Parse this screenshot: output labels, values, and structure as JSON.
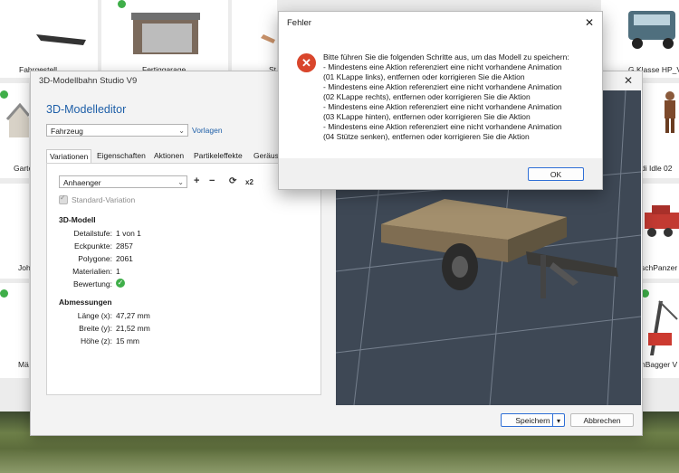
{
  "catalog": {
    "labels": [
      "Fahrgestell",
      "Fertiggarage",
      "St",
      "G Klasse HP_V",
      "Garte",
      "di Idle 02",
      "Joh",
      "schPanzer",
      "Mä",
      "nBagger V"
    ]
  },
  "editor": {
    "title": "3D-Modellbahn Studio V9",
    "close_glyph": "✕",
    "heading": "3D-Modelleditor",
    "category_select": "Fahrzeug",
    "vorlagen_link": "Vorlagen",
    "tabs": [
      "Variationen",
      "Eigenschaften",
      "Aktionen",
      "Partikeleffekte",
      "Geräus"
    ],
    "variation_select": "Anhaenger",
    "toolbar": {
      "add": "+",
      "remove": "−",
      "refresh": "⟳",
      "x2": "x2"
    },
    "standard_variation": "Standard-Variation",
    "model_section": "3D-Modell",
    "model_fields": [
      {
        "label": "Detailstufe:",
        "value": "1 von 1"
      },
      {
        "label": "Eckpunkte:",
        "value": "2857"
      },
      {
        "label": "Polygone:",
        "value": "2061"
      },
      {
        "label": "Materialien:",
        "value": "1"
      },
      {
        "label": "Bewertung:",
        "value": ""
      }
    ],
    "dimensions_section": "Abmessungen",
    "dimension_fields": [
      {
        "label": "Länge (x):",
        "value": "47,27 mm"
      },
      {
        "label": "Breite (y):",
        "value": "21,52 mm"
      },
      {
        "label": "Höhe (z):",
        "value": "15 mm"
      }
    ],
    "save_button": "Speichern",
    "cancel_button": "Abbrechen"
  },
  "dialog": {
    "title": "Fehler",
    "close_glyph": "✕",
    "message_lines": [
      "Bitte führen Sie die folgenden Schritte aus, um das Modell zu speichern:",
      "- Mindestens eine Aktion referenziert eine nicht vorhandene Animation",
      "(01 KLappe links), entfernen oder korrigieren Sie die Aktion",
      "- Mindestens eine Aktion referenziert eine nicht vorhandene Animation",
      "(02 KLappe rechts), entfernen oder korrigieren Sie die Aktion",
      "- Mindestens eine Aktion referenziert eine nicht vorhandene Animation",
      "(03 KLappe hinten), entfernen oder korrigieren Sie die Aktion",
      "- Mindestens eine Aktion referenziert eine nicht vorhandene Animation",
      "(04 Stütze senken), entfernen oder korrigieren Sie die Aktion"
    ],
    "ok_button": "OK"
  },
  "colors": {
    "accent": "#1e5fa8",
    "error": "#d9462c",
    "ok_green": "#3fae49",
    "viewport": "#3e4855"
  }
}
